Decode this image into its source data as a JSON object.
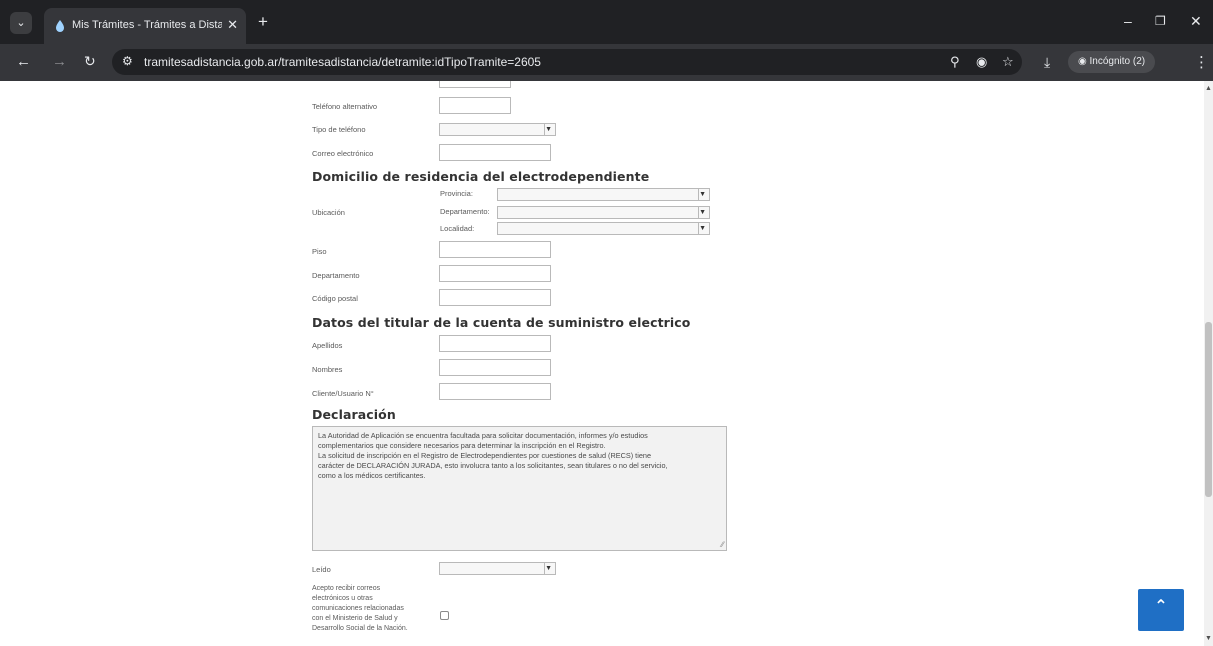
{
  "browser": {
    "tab_title": "Mis Trámites - Trámites a Dista",
    "url": "tramitesadistancia.gob.ar/tramitesadistancia/detramite:idTipoTramite=2605",
    "incognito_label": "Incógnito (2)"
  },
  "form": {
    "fields_top": [
      {
        "label": "Teléfono alternativo",
        "type": "input"
      },
      {
        "label": "Tipo de teléfono",
        "type": "select"
      },
      {
        "label": "Correo electrónico",
        "type": "input"
      }
    ],
    "domicilio": {
      "heading": "Domicilio de residencia del electrodependiente",
      "ubicacion_label": "Ubicación",
      "provincia_label": "Provincia:",
      "departamento_label": "Departamento:",
      "localidad_label": "Localidad:",
      "piso_label": "Piso",
      "depto_label": "Departamento",
      "cp_label": "Código postal"
    },
    "titular": {
      "heading": "Datos del titular de la cuenta de suministro electrico",
      "apellidos_label": "Apellidos",
      "nombres_label": "Nombres",
      "cliente_label": "Cliente/Usuario N°"
    },
    "declaracion": {
      "heading": "Declaración",
      "lines": [
        "La Autoridad de Aplicación se encuentra facultada para solicitar documentación, informes y/o estudios",
        "complementarios que considere necesarios para determinar la inscripción en el Registro.",
        "La solicitud de inscripción en el Registro de Electrodependientes por cuestiones de salud (RECS) tiene",
        "carácter de DECLARACIÓN JURADA, esto involucra tanto a los solicitantes, sean titulares o no del servicio,",
        "como a los médicos certificantes."
      ],
      "leido_label": "Leído",
      "acepto_lines": [
        "Acepto recibir correos",
        "electrónicos u otras",
        "comunicaciones relacionadas",
        "con el Ministerio de Salud y",
        "Desarrollo Social de la Nación."
      ]
    }
  },
  "colors": {
    "chrome_dark": "#202124",
    "chrome_toolbar": "#35363a",
    "fab_blue": "#1f6fc5",
    "heading": "#333333"
  }
}
